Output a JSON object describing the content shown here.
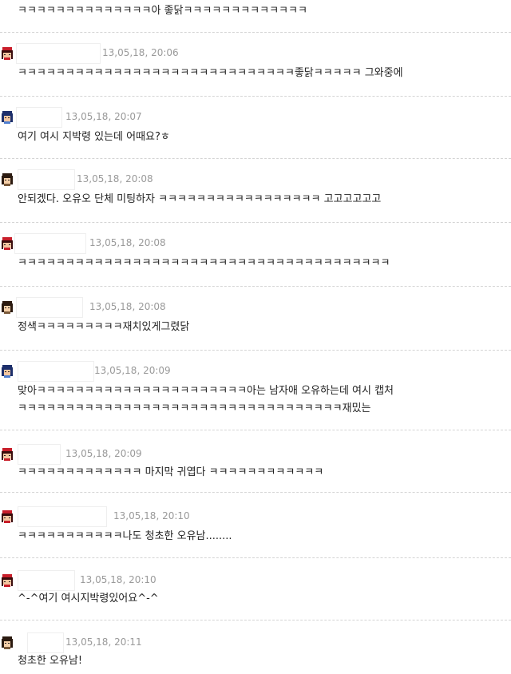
{
  "top_text": "ㅋㅋㅋㅋㅋㅋㅋㅋㅋㅋㅋㅋㅋㅋ아 좋닭ㅋㅋㅋㅋㅋㅋㅋㅋㅋㅋㅋㅋㅋ",
  "comments": [
    {
      "date": "13,05,18, 20:06",
      "lines": [
        "ㅋㅋㅋㅋㅋㅋㅋㅋㅋㅋㅋㅋㅋㅋㅋㅋㅋㅋㅋㅋㅋㅋㅋㅋㅋㅋㅋㅋㅋ좋닭ㅋㅋㅋㅋㅋ 그와중에"
      ],
      "avatar": "girl-red-icon"
    },
    {
      "date": "13,05,18, 20:07",
      "lines": [
        "여기 여시 지박령 있는데 어때요?ㅎ"
      ],
      "avatar": "girl-blue-icon"
    },
    {
      "date": "13,05,18, 20:08",
      "lines": [
        "안되겠다. 오유오 단체 미팅하자 ㅋㅋㅋㅋㅋㅋㅋㅋㅋㅋㅋㅋㅋㅋㅋㅋㅋ 고고고고고고"
      ],
      "avatar": "girl-dark-icon"
    },
    {
      "date": "13,05,18, 20:08",
      "lines": [
        "ㅋㅋㅋㅋㅋㅋㅋㅋㅋㅋㅋㅋㅋㅋㅋㅋㅋㅋㅋㅋㅋㅋㅋㅋㅋㅋㅋㅋㅋㅋㅋㅋㅋㅋㅋㅋㅋㅋㅋ"
      ],
      "avatar": "girl-red-icon"
    },
    {
      "date": "13,05,18, 20:08",
      "lines": [
        "정색ㅋㅋㅋㅋㅋㅋㅋㅋㅋ재치있게그렸닭"
      ],
      "avatar": "girl-dark-icon"
    },
    {
      "date": "13,05,18, 20:09",
      "lines": [
        "맞아ㅋㅋㅋㅋㅋㅋㅋㅋㅋㅋㅋㅋㅋㅋㅋㅋㅋㅋㅋㅋㅋㅋ아는 남자애 오유하는데 여시 캡처",
        "ㅋㅋㅋㅋㅋㅋㅋㅋㅋㅋㅋㅋㅋㅋㅋㅋㅋㅋㅋㅋㅋㅋㅋㅋㅋㅋㅋㅋㅋㅋㅋㅋㅋㅋ재밌는"
      ],
      "avatar": "girl-blue-icon"
    },
    {
      "date": "13,05,18, 20:09",
      "lines": [
        "ㅋㅋㅋㅋㅋㅋㅋㅋㅋㅋㅋㅋㅋ 마지막 귀엽다 ㅋㅋㅋㅋㅋㅋㅋㅋㅋㅋㅋㅋ"
      ],
      "avatar": "girl-red-icon"
    },
    {
      "date": "13,05,18, 20:10",
      "lines": [
        "ㅋㅋㅋㅋㅋㅋㅋㅋㅋㅋㅋ나도 청초한 오유남........"
      ],
      "avatar": "girl-red-icon"
    },
    {
      "date": "13,05,18, 20:10",
      "lines": [
        "^-^여기 여시지박령있어요^-^"
      ],
      "avatar": "girl-red-icon"
    },
    {
      "date": "13,05,18, 20:11",
      "lines": [
        "청초한 오유남!"
      ],
      "avatar": "girl-dark-icon"
    }
  ]
}
